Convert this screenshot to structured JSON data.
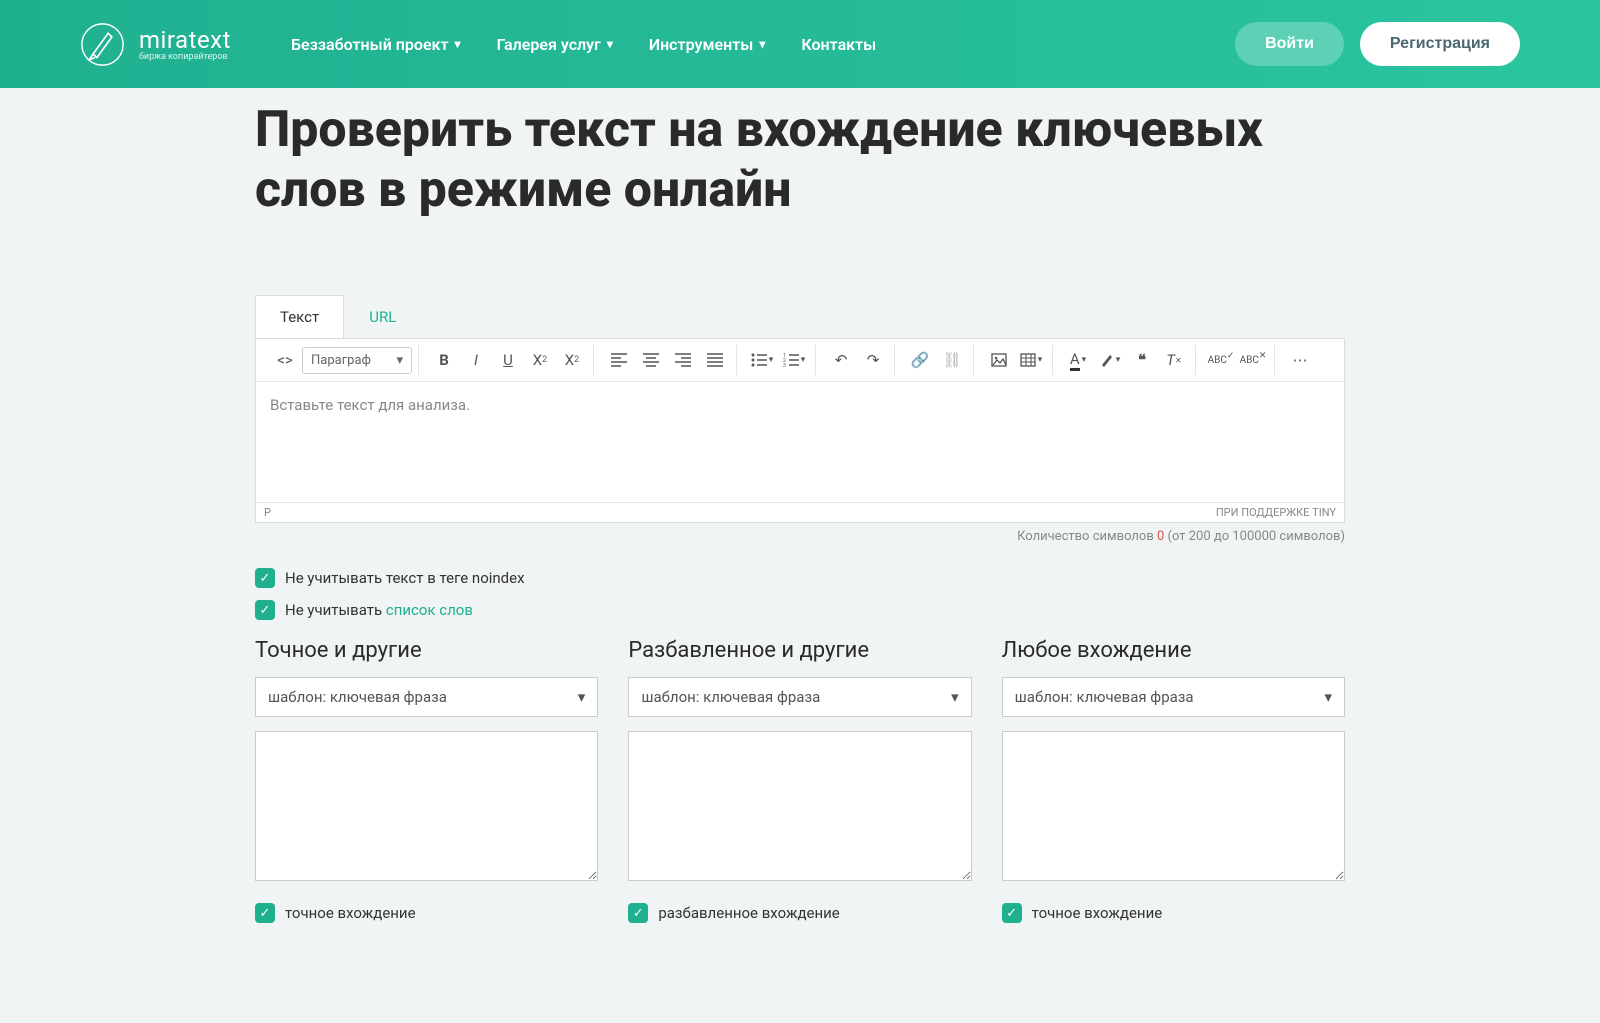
{
  "header": {
    "logo_text": "miratext",
    "logo_sub": "биржа копирайтеров",
    "nav": [
      {
        "label": "Беззаботный проект",
        "dropdown": true
      },
      {
        "label": "Галерея услуг",
        "dropdown": true
      },
      {
        "label": "Инструменты",
        "dropdown": true
      },
      {
        "label": "Контакты",
        "dropdown": false
      }
    ],
    "login_label": "Войти",
    "register_label": "Регистрация"
  },
  "page_title": "Проверить текст на вхождение ключевых слов в режиме онлайн",
  "tabs": [
    {
      "label": "Текст",
      "active": true
    },
    {
      "label": "URL",
      "active": false
    }
  ],
  "editor": {
    "paragraph_label": "Параграф",
    "placeholder": "Вставьте текст для анализа.",
    "footer_left": "P",
    "footer_right": "ПРИ ПОДДЕРЖКЕ TINY"
  },
  "char_count": {
    "prefix": "Количество символов ",
    "value": "0",
    "range": " (от 200 до 100000 символов)"
  },
  "checkboxes": {
    "noindex": "Не учитывать текст в теге noindex",
    "stopwords_prefix": "Не учитывать ",
    "stopwords_link": "список слов"
  },
  "columns": [
    {
      "title": "Точное и другие",
      "select_placeholder": "шаблон: ключевая фраза",
      "check_label": "точное вхождение"
    },
    {
      "title": "Разбавленное и другие",
      "select_placeholder": "шаблон: ключевая фраза",
      "check_label": "разбавленное вхождение"
    },
    {
      "title": "Любое вхождение",
      "select_placeholder": "шаблон: ключевая фраза",
      "check_label": "точное вхождение"
    }
  ]
}
